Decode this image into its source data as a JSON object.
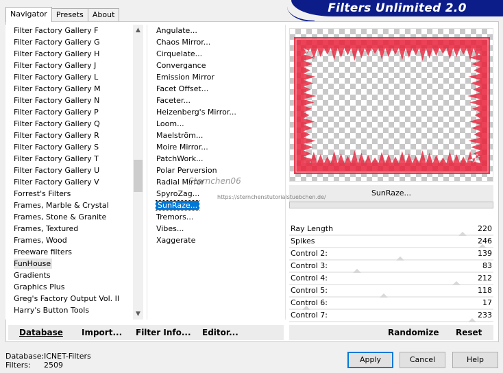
{
  "banner": {
    "title": "Filters Unlimited 2.0"
  },
  "tabs": [
    {
      "label": "Navigator",
      "active": true
    },
    {
      "label": "Presets",
      "active": false
    },
    {
      "label": "About",
      "active": false
    }
  ],
  "categories": [
    "Filter Factory Gallery F",
    "Filter Factory Gallery G",
    "Filter Factory Gallery H",
    "Filter Factory Gallery J",
    "Filter Factory Gallery L",
    "Filter Factory Gallery M",
    "Filter Factory Gallery N",
    "Filter Factory Gallery P",
    "Filter Factory Gallery Q",
    "Filter Factory Gallery R",
    "Filter Factory Gallery S",
    "Filter Factory Gallery T",
    "Filter Factory Gallery U",
    "Filter Factory Gallery V",
    "Forrest's Filters",
    "Frames, Marble & Crystal",
    "Frames, Stone & Granite",
    "Frames, Textured",
    "Frames, Wood",
    "Freeware filters",
    "FunHouse",
    "Gradients",
    "Graphics Plus",
    "Greg's Factory Output Vol. II",
    "Harry's Button Tools"
  ],
  "selected_category": "FunHouse",
  "filters": [
    "Angulate...",
    "Chaos Mirror...",
    "Cirquelate...",
    "Convergance",
    "Emission Mirror",
    "Facet Offset...",
    "Faceter...",
    "Heizenberg's Mirror...",
    "Loom...",
    "Maelström...",
    "Moire Mirror...",
    "PatchWork...",
    "Polar Perversion",
    "Radial Mirror",
    "SpyroZag...",
    "SunRaze...",
    "Tremors...",
    "Vibes...",
    "Xaggerate"
  ],
  "selected_filter": "SunRaze...",
  "preview": {
    "filter_name": "SunRaze..."
  },
  "controls": [
    {
      "label": "Ray Length",
      "value": 220
    },
    {
      "label": "Spikes",
      "value": 246
    },
    {
      "label": "Control 2:",
      "value": 139
    },
    {
      "label": "Control 3:",
      "value": 83
    },
    {
      "label": "Control 4:",
      "value": 212
    },
    {
      "label": "Control 5:",
      "value": 118
    },
    {
      "label": "Control 6:",
      "value": 17
    },
    {
      "label": "Control 7:",
      "value": 233
    }
  ],
  "control_max": 255,
  "toolbar": {
    "database": "Database",
    "import": "Import...",
    "filter_info": "Filter Info...",
    "editor": "Editor...",
    "randomize": "Randomize",
    "reset": "Reset"
  },
  "status": {
    "database_label": "Database:",
    "database_value": "ICNET-Filters",
    "filters_label": "Filters:",
    "filters_value": "2509"
  },
  "buttons": {
    "apply": "Apply",
    "cancel": "Cancel",
    "help": "Help"
  },
  "watermark": {
    "name": "Sternchen06",
    "url": "https://sternchenstutorialstuebchen.de/"
  },
  "colors": {
    "banner": "#0c1d8a",
    "selection": "#0078d7",
    "frame": "#e8213a"
  }
}
